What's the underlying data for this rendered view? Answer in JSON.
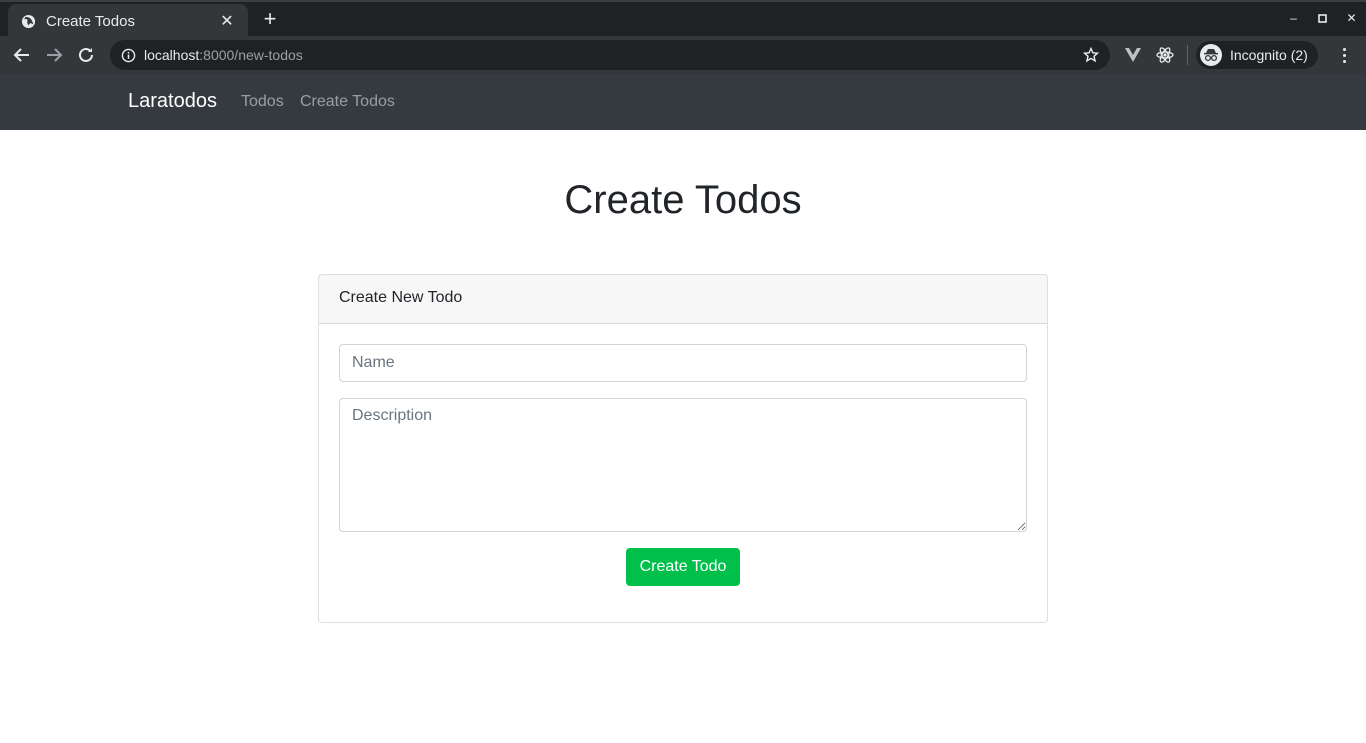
{
  "browser": {
    "tab": {
      "title": "Create Todos"
    },
    "url": {
      "host": "localhost",
      "rest": ":8000/new-todos"
    },
    "profile": {
      "label": "Incognito (2)"
    }
  },
  "navbar": {
    "brand": "Laratodos",
    "links": [
      {
        "label": "Todos"
      },
      {
        "label": "Create Todos"
      }
    ]
  },
  "main": {
    "title": "Create Todos",
    "card": {
      "header": "Create New Todo",
      "name_placeholder": "Name",
      "description_placeholder": "Description",
      "submit_label": "Create Todo"
    }
  },
  "colors": {
    "navbar_bg": "#343a40",
    "success": "#00c04b",
    "chrome_dark": "#202124",
    "chrome_toolbar": "#35363a"
  }
}
